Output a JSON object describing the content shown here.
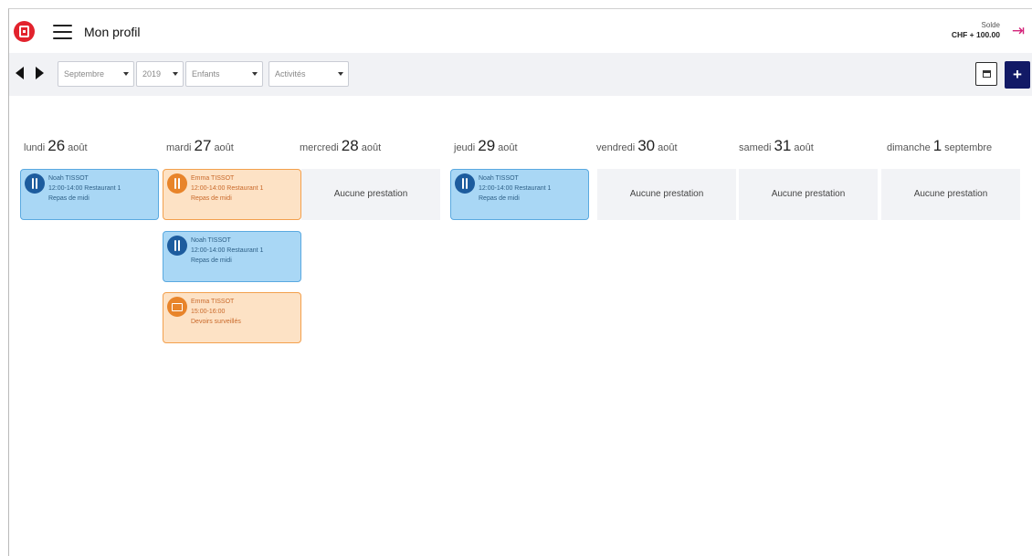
{
  "header": {
    "title": "Mon profil",
    "solde_label": "Solde",
    "solde_amount": "CHF + 100.00"
  },
  "toolbar": {
    "month": "Septembre",
    "year": "2019",
    "children": "Enfants",
    "activity": "Activités",
    "add_label": "+"
  },
  "days": [
    {
      "weekday": "lundi",
      "num": "26",
      "month": "août"
    },
    {
      "weekday": "mardi",
      "num": "27",
      "month": "août"
    },
    {
      "weekday": "mercredi",
      "num": "28",
      "month": "août"
    },
    {
      "weekday": "jeudi",
      "num": "29",
      "month": "août"
    },
    {
      "weekday": "vendredi",
      "num": "30",
      "month": "août"
    },
    {
      "weekday": "samedi",
      "num": "31",
      "month": "août"
    },
    {
      "weekday": "dimanche",
      "num": "1",
      "month": "septembre"
    }
  ],
  "empty_label": "Aucune prestation",
  "cards": {
    "mon_1": {
      "name": "Noah TISSOT",
      "time": "12:00-14:00 Restaurant 1",
      "desc": "Repas de midi",
      "icon": "utensils-icon"
    },
    "tue_1": {
      "name": "Emma TISSOT",
      "time": "12:00-14:00 Restaurant 1",
      "desc": "Repas de midi",
      "icon": "utensils-icon"
    },
    "tue_2": {
      "name": "Noah TISSOT",
      "time": "12:00-14:00 Restaurant 1",
      "desc": "Repas de midi",
      "icon": "utensils-icon"
    },
    "tue_3": {
      "name": "Emma TISSOT",
      "time": "15:00-16:00",
      "desc": "Devoirs surveillés",
      "icon": "books-icon"
    },
    "thu_1": {
      "name": "Noah TISSOT",
      "time": "12:00-14:00 Restaurant 1",
      "desc": "Repas de midi",
      "icon": "utensils-icon"
    }
  },
  "colors": {
    "brand_red": "#e2232d",
    "accent_navy": "#121a66",
    "logout_pink": "#d4237a",
    "card_blue": "#a9d7f5",
    "card_orange": "#fde2c5"
  }
}
